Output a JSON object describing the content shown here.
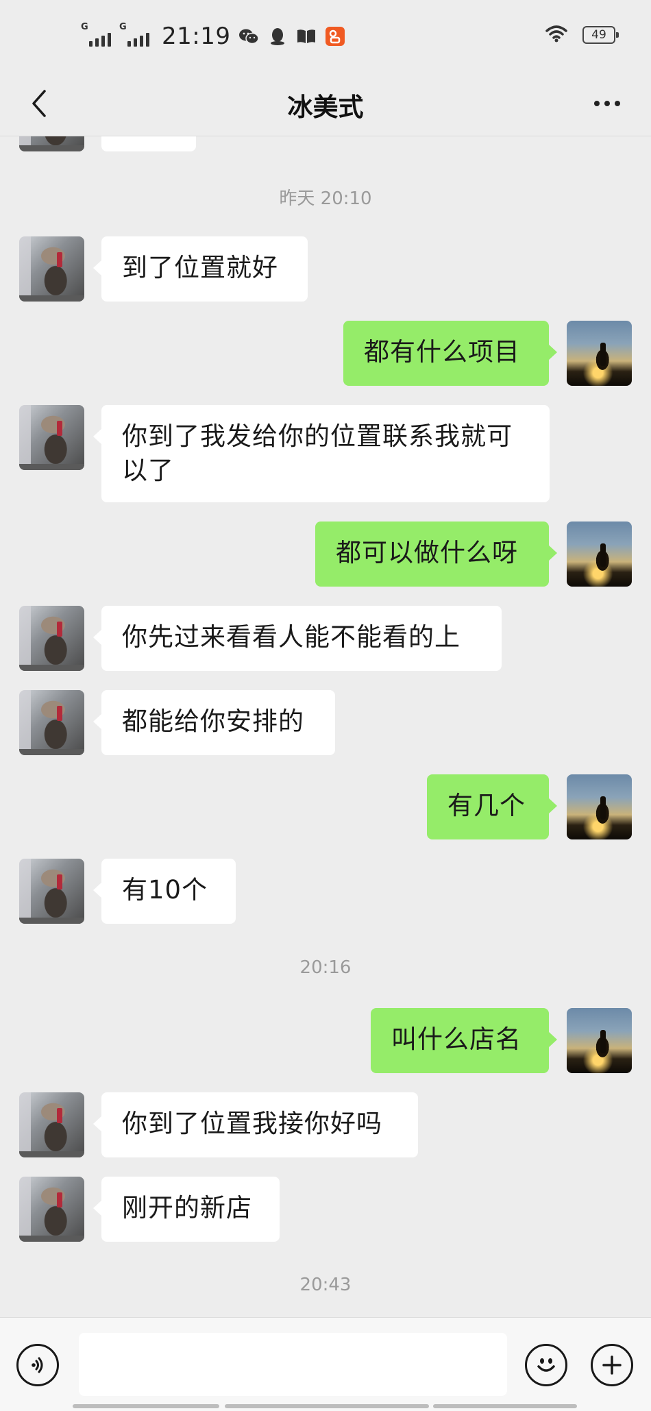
{
  "status_bar": {
    "time": "21:19",
    "signal_1_label": "G",
    "signal_2_label": "G",
    "battery": "49",
    "icons": [
      "signal-icon",
      "signal-icon",
      "wechat-icon",
      "qq-icon",
      "book-icon",
      "app-badge-icon",
      "wifi-icon",
      "battery-icon"
    ]
  },
  "nav": {
    "title": "冰美式",
    "back_icon": "chevron-left-icon",
    "more_icon": "more-icon"
  },
  "messages": {
    "ts_1": "昨天 20:10",
    "m1": "到了位置就好",
    "m2": "都有什么项目",
    "m3": "你到了我发给你的位置联系我就可以了",
    "m4": "都可以做什么呀",
    "m5": "你先过来看看人能不能看的上",
    "m6": "都能给你安排的",
    "m7": "有几个",
    "m8": "有10个",
    "ts_2": "20:16",
    "m9": "叫什么店名",
    "m10": "你到了位置我接你好吗",
    "m11": "刚开的新店",
    "ts_3": "20:43"
  },
  "colors": {
    "background": "#ededed",
    "outgoing_bubble": "#95ec69",
    "incoming_bubble": "#ffffff",
    "timestamp_text": "#9a9a9a"
  },
  "input_bar": {
    "voice_icon": "voice-icon",
    "emoji_icon": "emoji-icon",
    "plus_icon": "plus-icon"
  }
}
